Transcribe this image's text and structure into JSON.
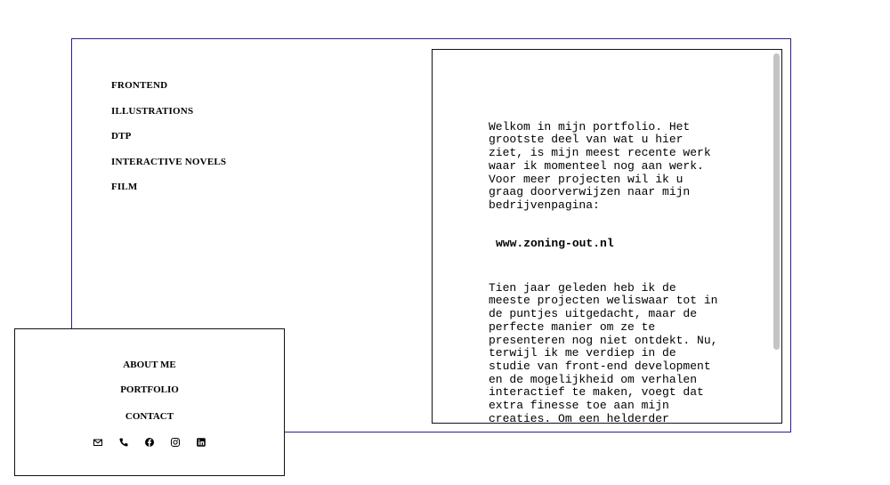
{
  "nav": {
    "items": [
      "FRONTEND",
      "ILLUSTRATIONS",
      "DTP",
      "INTERACTIVE NOVELS",
      "FILM"
    ]
  },
  "content": {
    "intro": "Welkom in mijn portfolio. Het grootste deel van wat u hier ziet, is mijn meest recente werk waar ik momenteel nog aan werk. Voor meer projecten wil ik u graag doorverwijzen naar mijn bedrijvenpagina:",
    "link": "www.zoning-out.nl",
    "body": "Tien jaar geleden heb ik de meeste projecten weliswaar tot in de puntjes uitgedacht, maar de perfecte manier om ze te presenteren nog niet ontdekt. Nu, terwijl ik me verdiep in de studie van front-end development en de mogelijkheid om verhalen interactief te maken, voegt dat extra finesse toe aan mijn creaties. Om een helderder overzicht te creëren, heb ik mijn projecten ontleed en per discipline de bijbehorende"
  },
  "footer": {
    "about": "ABOUT ME",
    "portfolio": "PORTFOLIO",
    "contact": "CONTACT",
    "icons": [
      "mail-icon",
      "phone-icon",
      "facebook-icon",
      "instagram-icon",
      "linkedin-icon"
    ]
  },
  "colors": {
    "frame_border": "#2a1f8f",
    "scrollbar": "#c4c4c4"
  }
}
